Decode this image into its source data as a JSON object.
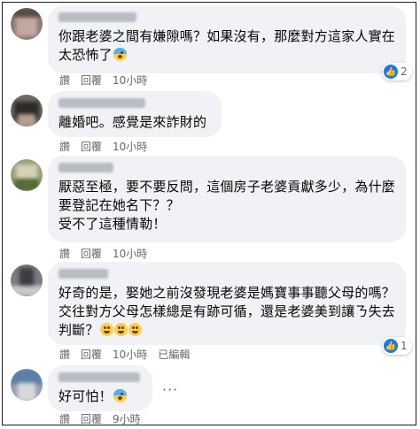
{
  "comments": [
    {
      "lines": [
        "你跟老婆之間有嫌隙嗎？如果沒有，那麼對方這家人實在",
        "太恐怖了"
      ],
      "emoji": "fear",
      "actions": {
        "like": "讚",
        "reply": "回覆",
        "time": "10小時"
      },
      "reaction_count": "2"
    },
    {
      "lines": [
        "離婚吧。感覺是來詐財的"
      ],
      "actions": {
        "like": "讚",
        "reply": "回覆",
        "time": "10小時"
      }
    },
    {
      "lines": [
        "厭惡至極，要不要反問，這個房子老婆貢獻多少，為什麼",
        "要登記在她名下？？",
        "受不了這種情勒！"
      ],
      "actions": {
        "like": "讚",
        "reply": "回覆",
        "time": "10小時"
      }
    },
    {
      "lines": [
        "好奇的是，娶她之前沒發現老婆是媽寶事事聽父母的嗎？",
        "交往對方父母怎樣總是有跡可循，還是老婆美到讓ㄋ失去",
        "判斷？"
      ],
      "emoji_trail": 3,
      "actions": {
        "like": "讚",
        "reply": "回覆",
        "time": "10小時",
        "edited": "已編輯"
      },
      "reaction_count": "1"
    },
    {
      "lines": [
        "好可怕！"
      ],
      "emoji": "fear",
      "actions": {
        "like": "讚",
        "reply": "回覆",
        "time": "9小時"
      },
      "more": "···"
    }
  ],
  "colors": {
    "bubble": "#f0f2f5",
    "meta_text": "#65676b",
    "like_blue": "#1877f2"
  }
}
